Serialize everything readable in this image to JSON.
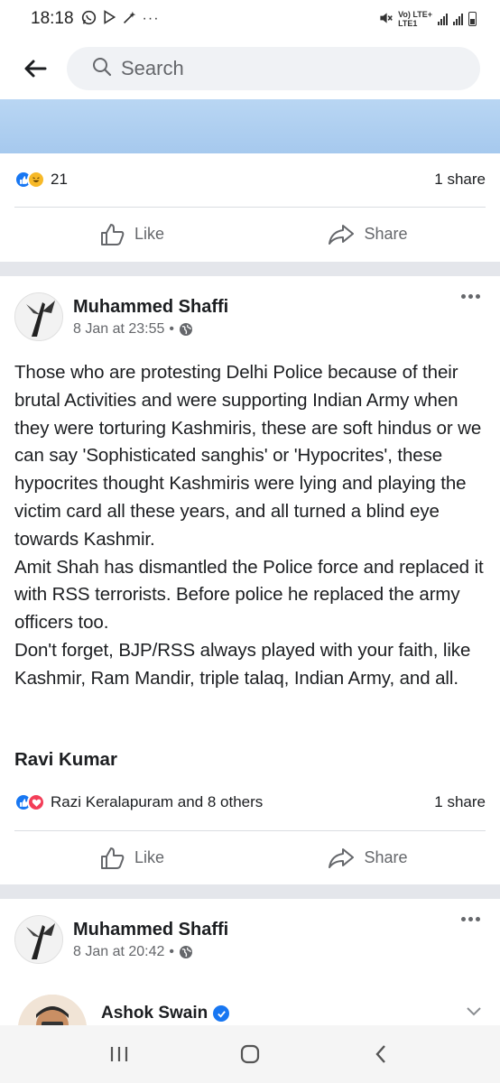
{
  "status_bar": {
    "time": "18:18",
    "network_label_top": "Vo) LTE+",
    "network_label_bottom": "LTE1"
  },
  "search": {
    "placeholder": "Search"
  },
  "first_post": {
    "reaction_count": "21",
    "share_count": "1 share",
    "like_label": "Like",
    "share_label": "Share"
  },
  "second_post": {
    "author": "Muhammed Shaffi",
    "timestamp": "8 Jan at 23:55",
    "meta_separator": "•",
    "paragraphs": [
      "Those who are protesting Delhi Police because of their brutal Activities and were supporting Indian Army when they were torturing Kashmiris, these are soft hindus or we can say 'Sophisticated sanghis' or 'Hypocrites', these hypocrites thought Kashmiris were lying and playing the victim card all these years, and all turned a blind eye towards Kashmir.",
      "Amit Shah has dismantled the Police force and replaced it with RSS terrorists. Before police he replaced the army officers too.",
      "Don't forget, BJP/RSS always played with your faith, like Kashmir, Ram Mandir, triple talaq, Indian Army, and all."
    ],
    "signature": "Ravi Kumar",
    "reactions_text": "Razi Keralapuram and 8 others",
    "share_count": "1 share",
    "like_label": "Like",
    "share_label": "Share"
  },
  "third_post": {
    "author": "Muhammed Shaffi",
    "timestamp": "8 Jan at 20:42",
    "meta_separator": "•",
    "shared_author": "Ashok Swain"
  },
  "colors": {
    "brand_blue": "#1877f2",
    "love_red": "#f33e58",
    "haha_yellow": "#f7b928",
    "divider": "#e4e6eb"
  },
  "icons": [
    "whatsapp-icon",
    "play-store-icon",
    "magic-wand-icon",
    "more-dots-icon",
    "mute-icon",
    "signal-icon",
    "battery-icon",
    "back-arrow-icon",
    "search-icon",
    "like-icon",
    "share-icon",
    "globe-icon",
    "verified-icon",
    "chevron-down-icon",
    "recent-apps-icon",
    "home-icon",
    "nav-back-icon"
  ]
}
